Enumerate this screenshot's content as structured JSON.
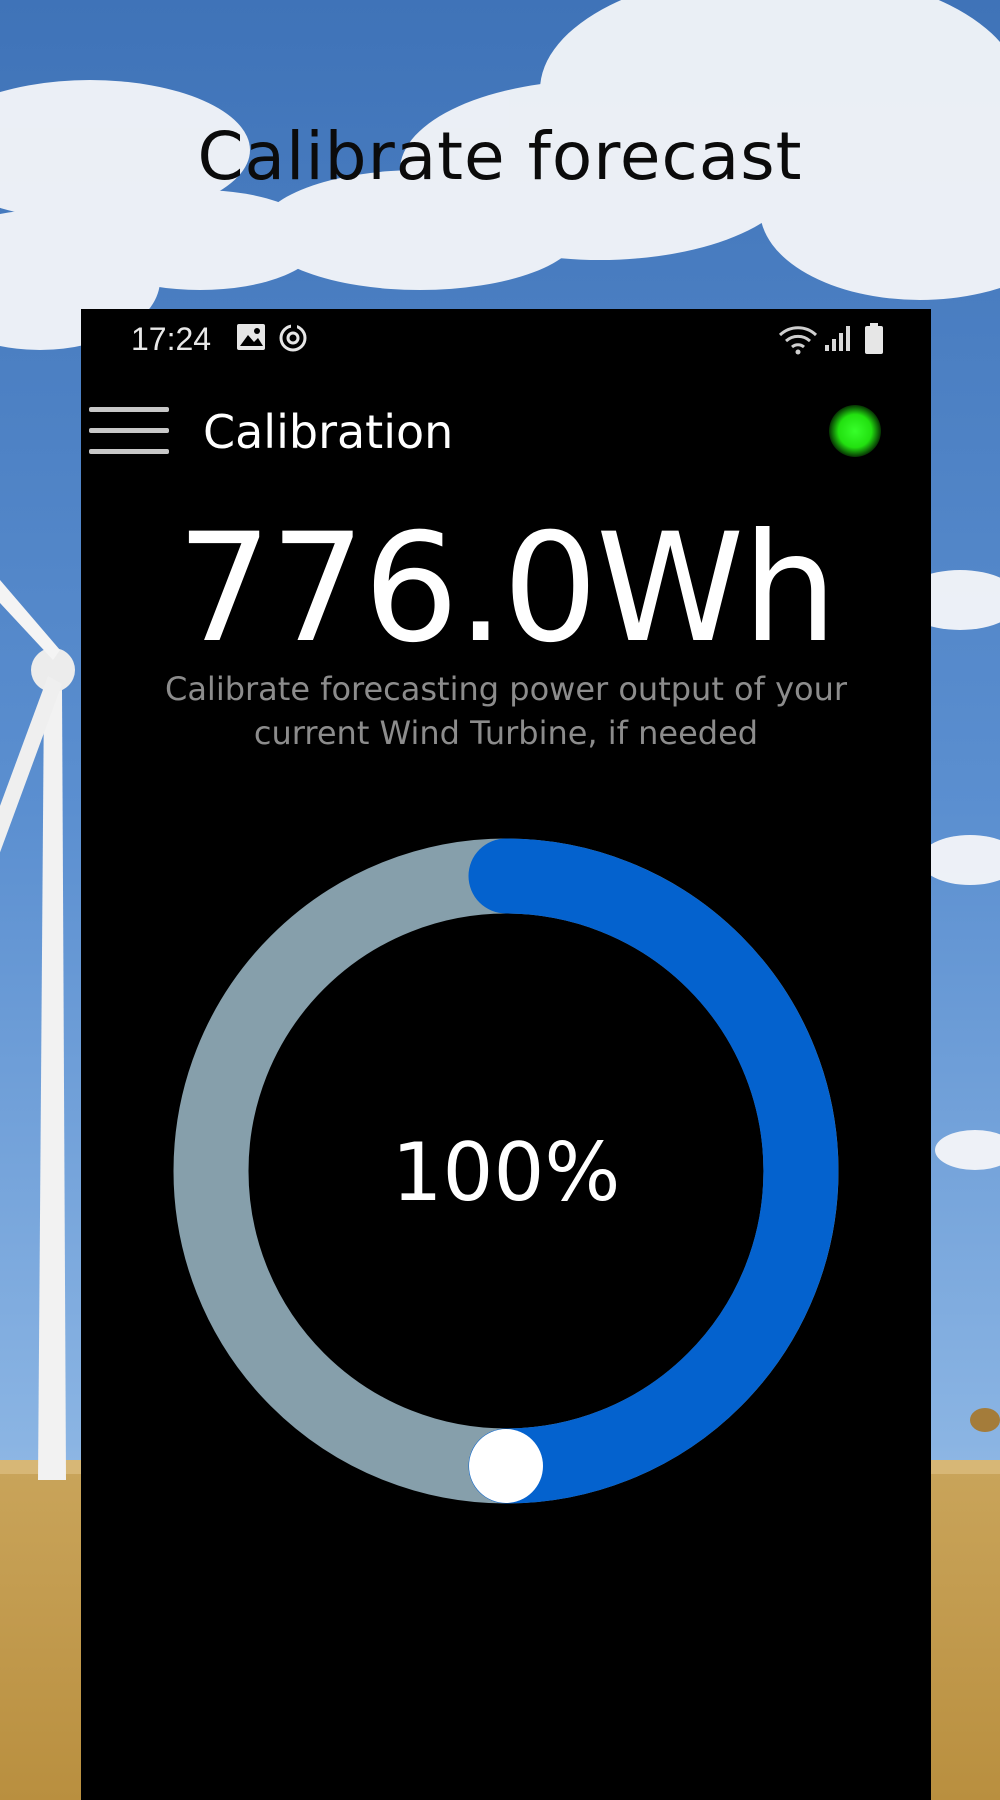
{
  "promo": {
    "title": "Calibrate forecast"
  },
  "statusbar": {
    "time": "17:24",
    "left_icons": [
      "image-icon",
      "sync-icon"
    ],
    "right_icons": [
      "wifi-icon",
      "signal-icon",
      "battery-icon"
    ]
  },
  "appbar": {
    "menu_icon": "hamburger-menu-icon",
    "title": "Calibration",
    "status_indicator_color": "#22e010"
  },
  "reading": {
    "value": "776.0Wh",
    "description": "Calibrate forecasting power output of your current Wind Turbine, if needed"
  },
  "calibration_gauge": {
    "label": "100%",
    "fill_fraction": 0.5,
    "colors": {
      "progress": "#0462ce",
      "track": "#869fab",
      "handle": "#ffffff"
    }
  },
  "colors": {
    "screen_background": "#000000",
    "primary_text": "#ffffff",
    "secondary_text": "#8c8c8c"
  }
}
